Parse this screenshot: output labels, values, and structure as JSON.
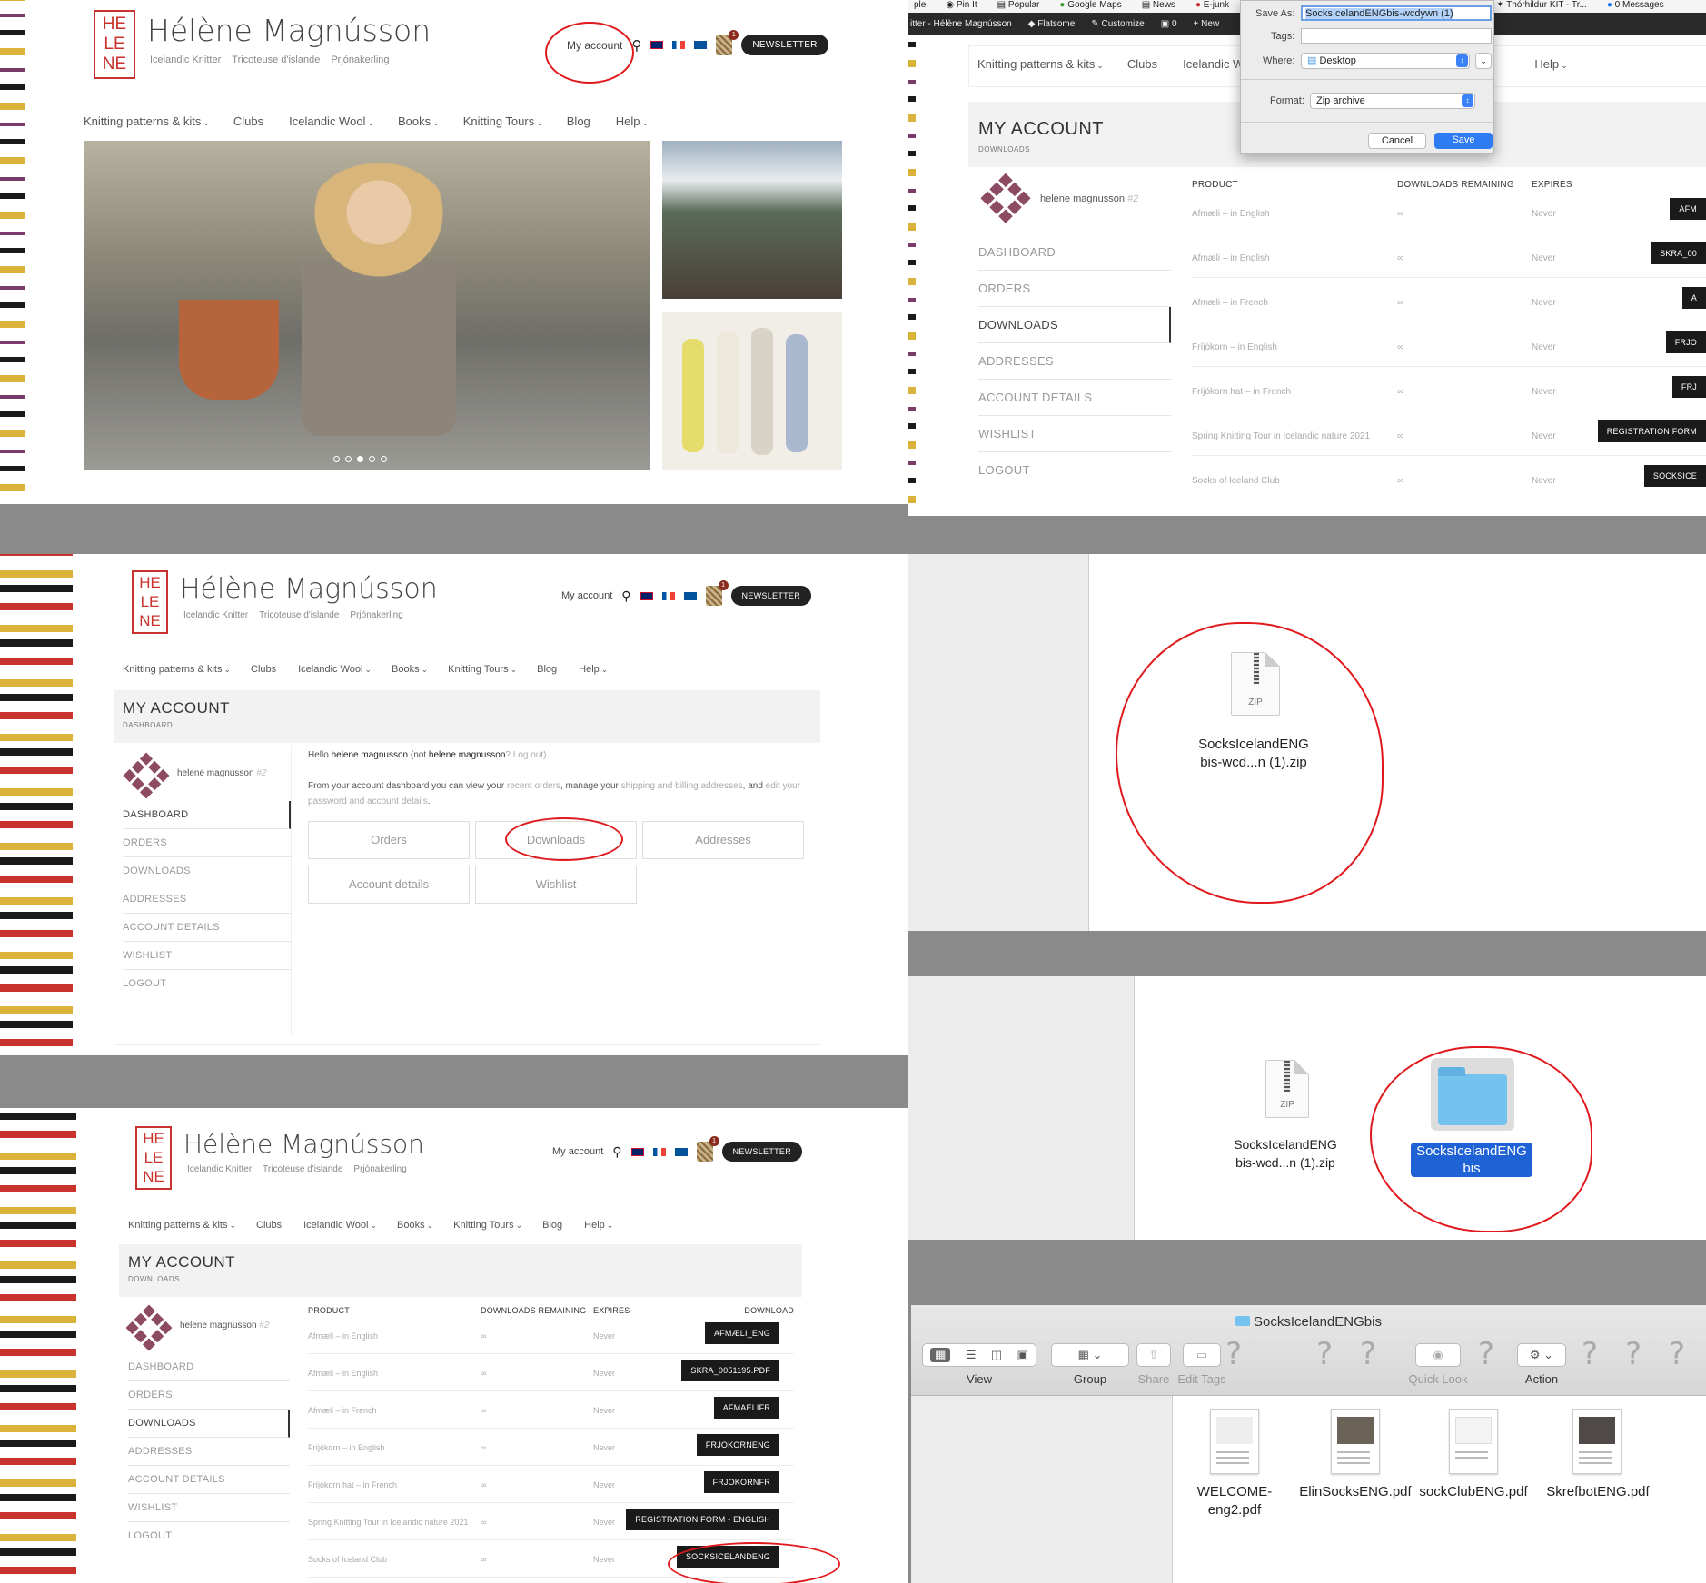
{
  "site": {
    "logo_lines": [
      "HE",
      "LE",
      "NE"
    ],
    "brand": "Hélène Magnússon",
    "taglines": [
      "Icelandic Knitter",
      "Tricoteuse d'islande",
      "Prjónakerling"
    ],
    "my_account": "My account",
    "newsletter": "NEWSLETTER",
    "cart_count": "1",
    "nav": [
      "Knitting patterns & kits",
      "Clubs",
      "Icelandic Wool",
      "Books",
      "Knitting Tours",
      "Blog",
      "Help"
    ],
    "nav_dropdown": [
      true,
      false,
      true,
      true,
      true,
      false,
      true
    ]
  },
  "account": {
    "title": "MY ACCOUNT",
    "sub_dashboard": "DASHBOARD",
    "sub_downloads": "DOWNLOADS",
    "user": "helene magnusson",
    "user_num": "#2",
    "sidebar": [
      "DASHBOARD",
      "ORDERS",
      "DOWNLOADS",
      "ADDRESSES",
      "ACCOUNT DETAILS",
      "WISHLIST",
      "LOGOUT"
    ],
    "hello_prefix": "Hello",
    "hello_name": "helene magnusson",
    "hello_not": "(not",
    "hello_not_name": "helene magnusson",
    "hello_logout": "? Log out)",
    "intro_a": "From your account dashboard you can view your",
    "intro_link1": "recent orders",
    "intro_b": ", manage your",
    "intro_link2": "shipping and billing addresses",
    "intro_c": ", and",
    "intro_link3": "edit your",
    "intro_link4": "password and account details",
    "intro_end": ".",
    "dash_buttons": [
      "Orders",
      "Downloads",
      "Addresses",
      "Account details",
      "Wishlist"
    ],
    "columns": [
      "PRODUCT",
      "DOWNLOADS REMAINING",
      "EXPIRES",
      "DOWNLOAD"
    ],
    "downloads": [
      {
        "product": "Afmæli – in English",
        "remaining": "∞",
        "expires": "Never",
        "file": "AFMÆLI_ENG",
        "file_cut": "AFM"
      },
      {
        "product": "Afmæli – in English",
        "remaining": "∞",
        "expires": "Never",
        "file": "SKRA_0051195.PDF",
        "file_cut": "SKRA_00"
      },
      {
        "product": "Afmæli – in French",
        "remaining": "∞",
        "expires": "Never",
        "file": "AFMAELIFR",
        "file_cut": "A"
      },
      {
        "product": "Fríjókorn – in English",
        "remaining": "∞",
        "expires": "Never",
        "file": "FRJOKORNENG",
        "file_cut": "FRJO"
      },
      {
        "product": "Fríjókorn hat – in French",
        "remaining": "∞",
        "expires": "Never",
        "file": "FRJOKORNFR",
        "file_cut": "FRJ"
      },
      {
        "product": "Spring Knitting Tour in Icelandic nature 2021",
        "remaining": "∞",
        "expires": "Never",
        "file": "REGISTRATION FORM - ENGLISH",
        "file_cut": "REGISTRATION FORM"
      },
      {
        "product": "Socks of Iceland Club",
        "remaining": "∞",
        "expires": "Never",
        "file": "SOCKSICELANDENG",
        "file_cut": "SOCKSICE"
      }
    ]
  },
  "mac": {
    "menubar": [
      "ple",
      "Pin It",
      "Popular",
      "Google Maps",
      "News",
      "E-junk",
      "Thórhildur KIT - Tr...",
      "0 Messages"
    ],
    "admin_bar": [
      "itter - Hélène Magnússon",
      "Flatsome",
      "Customize",
      "0",
      "New"
    ],
    "save_as_label": "Save As:",
    "save_as_value": "SocksIcelandENGbis-wcdywn (1)",
    "tags_label": "Tags:",
    "where_label": "Where:",
    "where_value": "Desktop",
    "format_label": "Format:",
    "format_value": "Zip archive",
    "cancel": "Cancel",
    "save": "Save",
    "nav_partial": [
      "Knitting patterns & kits",
      "Clubs",
      "Icelandic W",
      "Help"
    ]
  },
  "finder": {
    "zip_label": "ZIP",
    "zip_name_1": "SocksIcelandENG",
    "zip_name_2": "bis-wcd...n (1).zip",
    "folder_name_1": "SocksIcelandENG",
    "folder_name_2": "bis",
    "window_title": "SocksIcelandENGbis",
    "toolbar": [
      "View",
      "Group",
      "Share",
      "Edit Tags",
      "Quick Look",
      "Action"
    ],
    "files": [
      {
        "name_1": "WELCOME-",
        "name_2": "eng2.pdf"
      },
      {
        "name_1": "ElinSocksENG.pdf",
        "name_2": ""
      },
      {
        "name_1": "sockClubENG.pdf",
        "name_2": ""
      },
      {
        "name_1": "SkrefbotENG.pdf",
        "name_2": ""
      }
    ]
  }
}
